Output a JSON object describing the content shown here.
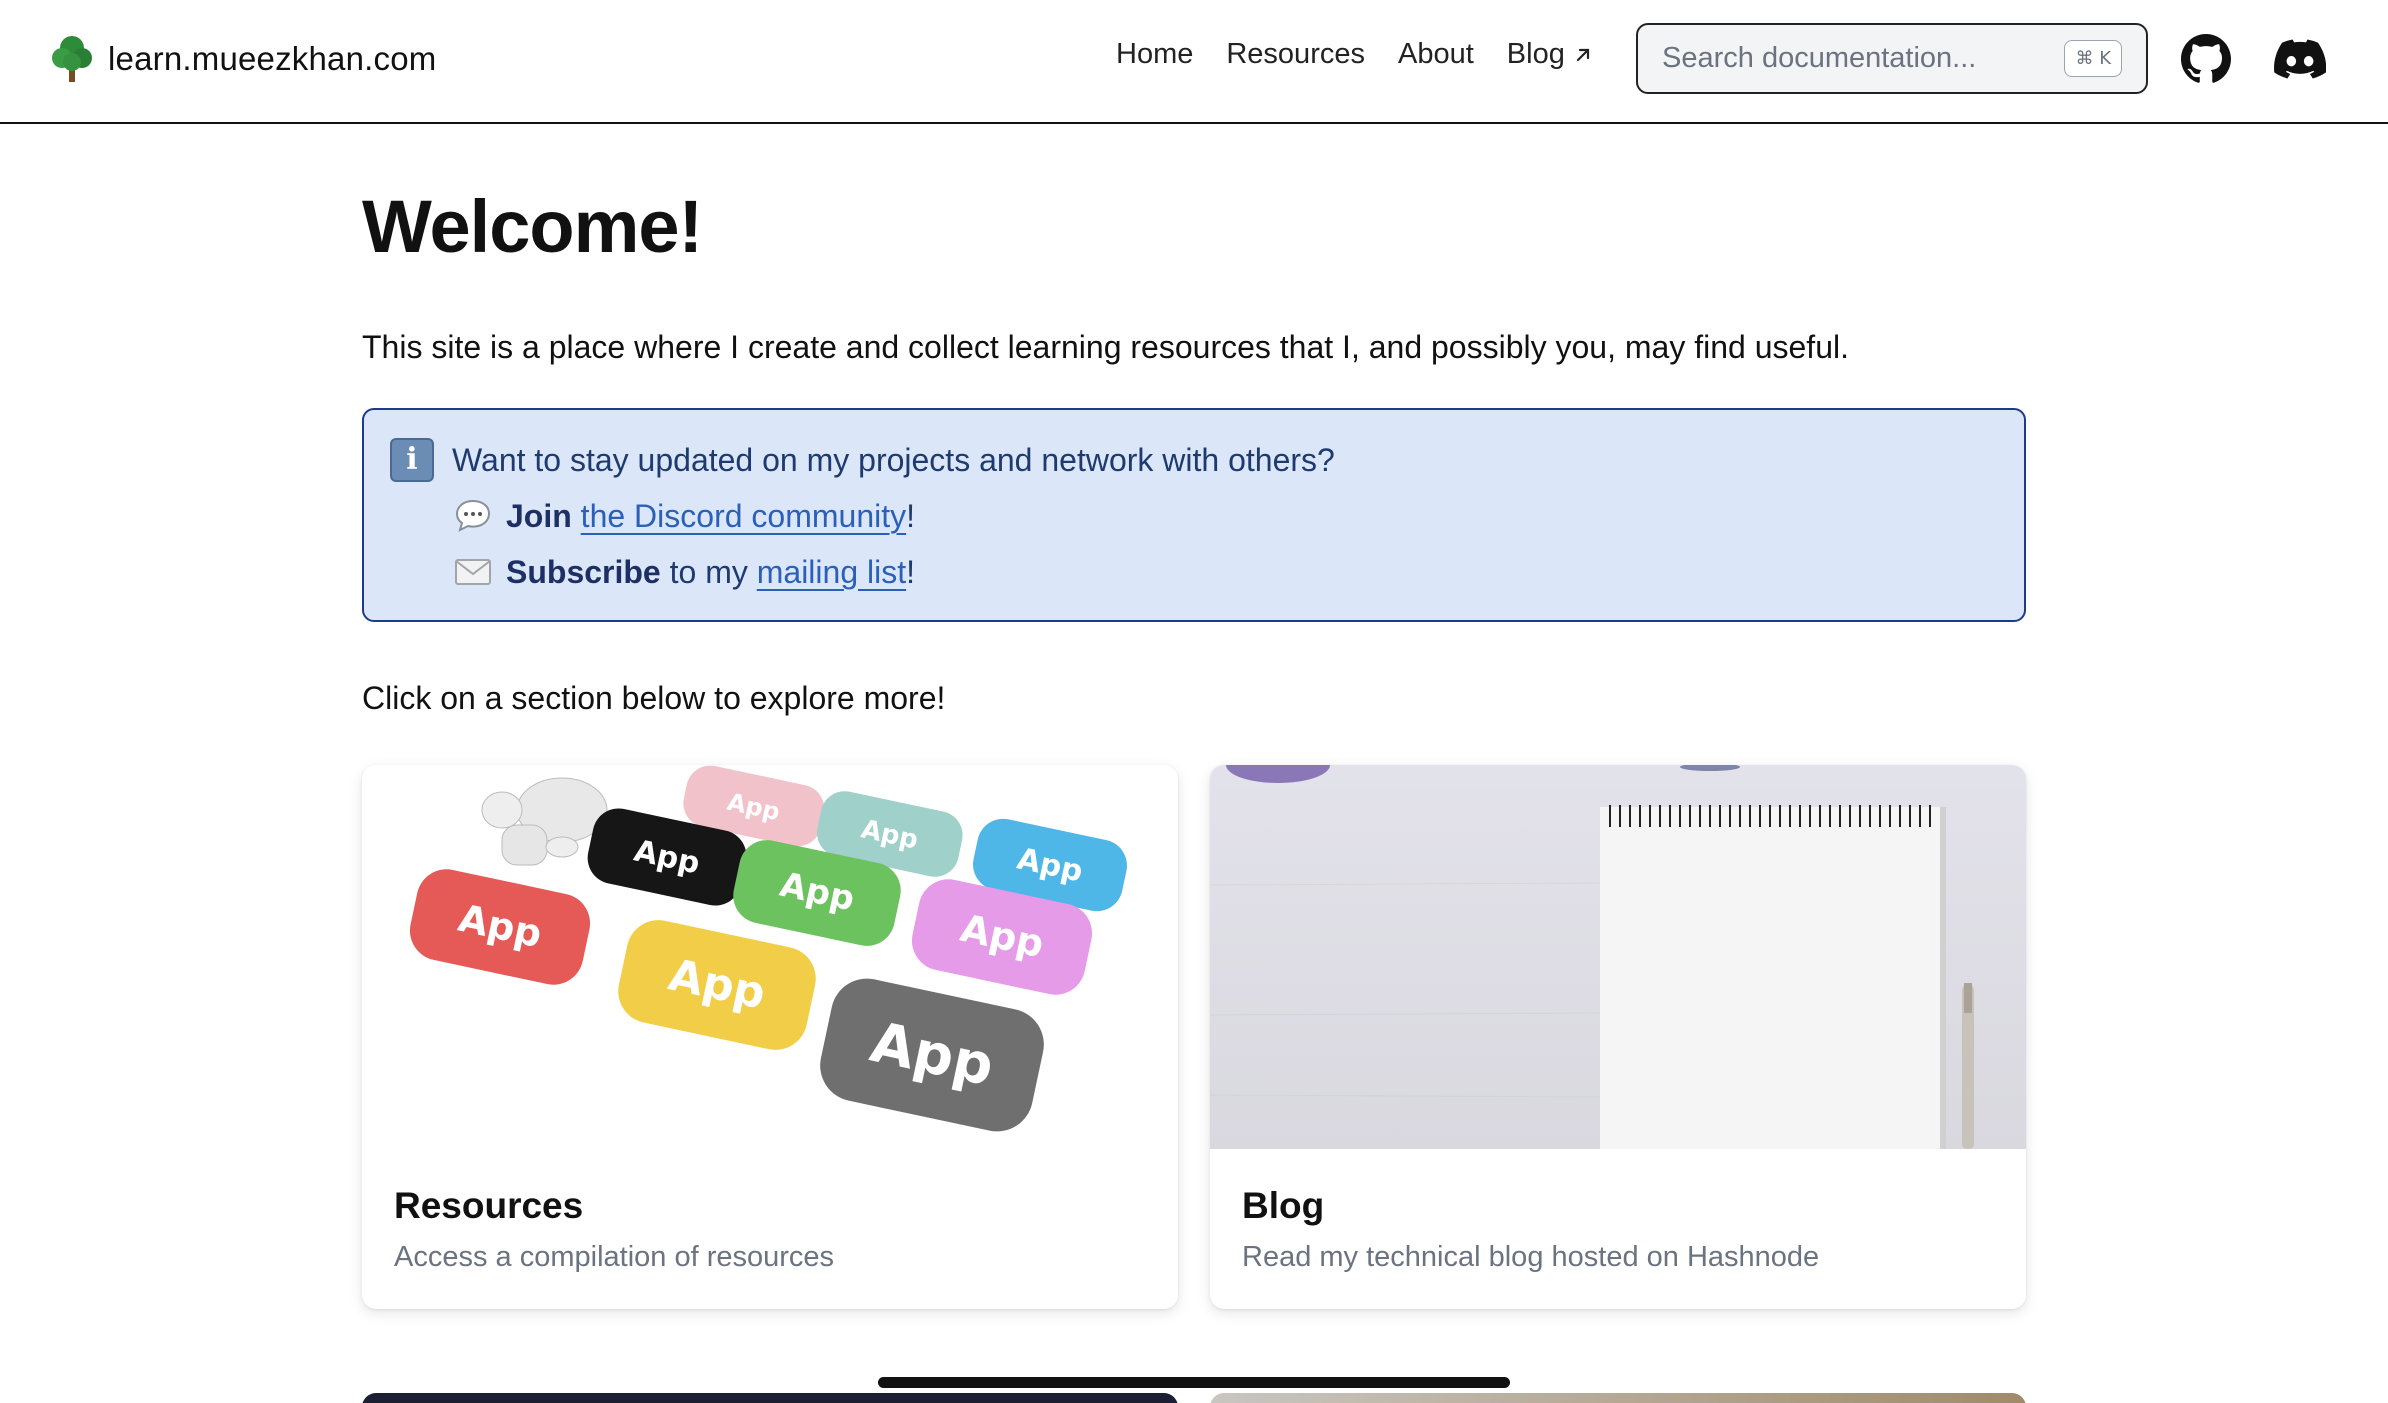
{
  "navbar": {
    "brand": "learn.mueezkhan.com",
    "links": [
      {
        "label": "Home"
      },
      {
        "label": "Resources"
      },
      {
        "label": "About"
      },
      {
        "label": "Blog"
      }
    ],
    "search_placeholder": "Search documentation...",
    "search_shortcut": "⌘ K",
    "icons": [
      "github-icon",
      "discord-icon"
    ]
  },
  "main": {
    "title": "Welcome!",
    "intro": "This site is a place where I create and collect learning resources that I, and possibly you, may find useful.",
    "callout": {
      "heading": "Want to stay updated on my projects and network with others?",
      "discord_bold": "Join",
      "discord_link": "the Discord community",
      "discord_end": "!",
      "mail_bold": "Subscribe",
      "mail_mid": " to my ",
      "mail_link": "mailing list",
      "mail_end": "!"
    },
    "explore": "Click on a section below to explore more!",
    "cards": [
      {
        "title": "Resources",
        "description": "Access a compilation of resources",
        "image_labels": [
          "App",
          "App",
          "App",
          "App",
          "App",
          "App",
          "App",
          "App"
        ]
      },
      {
        "title": "Blog",
        "description": "Read my technical blog hosted on Hashnode"
      }
    ]
  },
  "colors": {
    "callout_bg": "#dbe7f9",
    "callout_border": "#1e3a8a",
    "link": "#2b5fb8"
  }
}
